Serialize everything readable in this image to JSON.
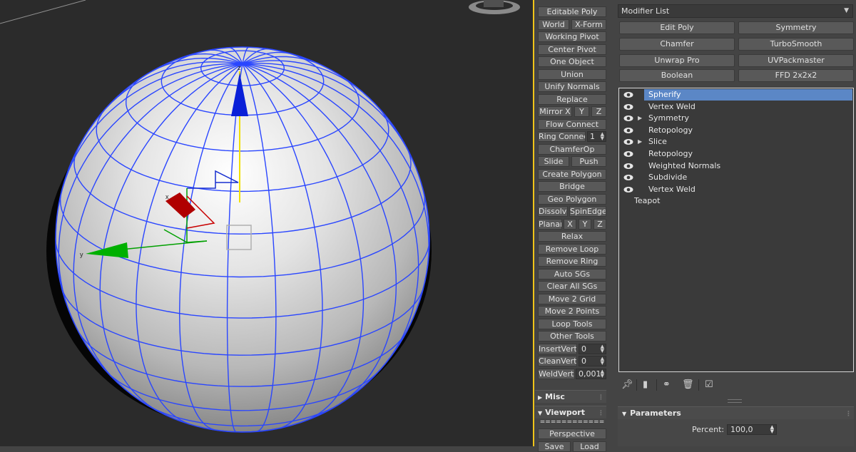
{
  "colors": {
    "viewport_bg": "#2b2b2b",
    "wire": "#2a46ff",
    "selection_highlight": "#5b87c6",
    "panel_bg": "#444444",
    "separator": "#f0c419",
    "gizmo_x": "#c80000",
    "gizmo_y": "#00a000",
    "gizmo_z": "#0018c8"
  },
  "viewport": {
    "gizmo_labels": {
      "x": "x",
      "y": "y",
      "z": "z"
    }
  },
  "toolbar": {
    "editable_poly": "Editable Poly",
    "world": "World",
    "x_form": "X-Form",
    "working_pivot": "Working Pivot",
    "center_pivot": "Center Pivot",
    "one_object": "One Object",
    "union": "Union",
    "unify_normals": "Unify Normals",
    "replace": "Replace",
    "mirror_x": "Mirror X",
    "mirror_y": "Y",
    "mirror_z": "Z",
    "flow_connect": "Flow Connect",
    "ring_connect": "Ring Connect",
    "ring_connect_value": "1",
    "chamferop": "ChamferOp",
    "slide": "Slide",
    "push": "Push",
    "create_polygon": "Create Polygon",
    "bridge": "Bridge",
    "geo_polygon": "Geo Polygon",
    "dissolve": "Dissolve",
    "spinedge": "SpinEdge",
    "planar": "Planar",
    "planar_x": "X",
    "planar_y": "Y",
    "planar_z": "Z",
    "relax": "Relax",
    "remove_loop": "Remove Loop",
    "remove_ring": "Remove Ring",
    "auto_sgs": "Auto SGs",
    "clear_all_sgs": "Clear All SGs",
    "move_2_grid": "Move 2 Grid",
    "move_2_points": "Move 2 Points",
    "loop_tools": "Loop Tools",
    "other_tools": "Other Tools",
    "insertverts": "InsertVerts",
    "insertverts_value": "0",
    "cleanverts": "CleanVerts",
    "cleanverts_value": "0",
    "weldverts": "WeldVerts",
    "weldverts_value": "0,001",
    "misc": "Misc",
    "viewport_rollout": "Viewport",
    "viewport_divider": "============",
    "perspective": "Perspective",
    "save": "Save",
    "load": "Load"
  },
  "command_panel": {
    "modifier_list": "Modifier List",
    "modifier_buttons": [
      "Edit Poly",
      "Symmetry",
      "Chamfer",
      "TurboSmooth",
      "Unwrap Pro",
      "UVPackmaster",
      "Boolean",
      "FFD 2x2x2"
    ],
    "stack": [
      {
        "label": "Spherify",
        "eye": true,
        "expand": false,
        "selected": true
      },
      {
        "label": "Vertex Weld",
        "eye": true,
        "expand": false,
        "selected": false
      },
      {
        "label": "Symmetry",
        "eye": true,
        "expand": true,
        "selected": false
      },
      {
        "label": "Retopology",
        "eye": true,
        "expand": false,
        "selected": false
      },
      {
        "label": "Slice",
        "eye": true,
        "expand": true,
        "selected": false
      },
      {
        "label": "Retopology",
        "eye": true,
        "expand": false,
        "selected": false
      },
      {
        "label": "Weighted Normals",
        "eye": true,
        "expand": false,
        "selected": false
      },
      {
        "label": "Subdivide",
        "eye": true,
        "expand": false,
        "selected": false
      },
      {
        "label": "Vertex Weld",
        "eye": true,
        "expand": false,
        "selected": false
      },
      {
        "label": "Teapot",
        "eye": false,
        "expand": false,
        "selected": false
      }
    ],
    "parameters": {
      "title": "Parameters",
      "percent_label": "Percent:",
      "percent_value": "100,0"
    }
  }
}
